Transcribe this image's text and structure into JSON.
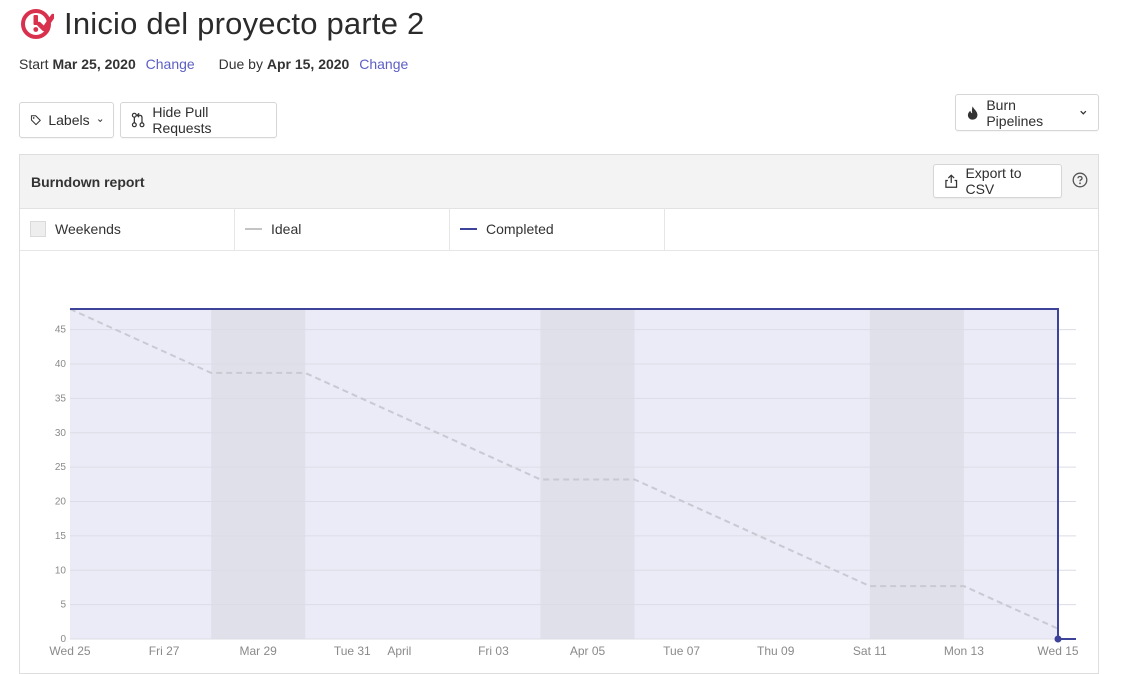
{
  "header": {
    "title": "Inicio del proyecto parte 2",
    "icon": "milestone-check-icon",
    "icon_color": "#d9304e"
  },
  "dates": {
    "start_label": "Start",
    "start_value": "Mar 25, 2020",
    "start_change": "Change",
    "due_label": "Due by",
    "due_value": "Apr 15, 2020",
    "due_change": "Change",
    "link_color": "#5c5fc4"
  },
  "toolbar": {
    "labels_button": "Labels",
    "hide_pr_button": "Hide Pull Requests",
    "burn_button": "Burn Pipelines"
  },
  "report": {
    "title": "Burndown report",
    "export_button": "Export to CSV"
  },
  "legend": {
    "weekends": "Weekends",
    "ideal": "Ideal",
    "completed": "Completed"
  },
  "colors": {
    "completed": "#3c4399",
    "ideal": "#c9c9d3",
    "plot_bg": "#ebebf7",
    "weekend_bg": "#e0e0ea"
  },
  "chart_data": {
    "type": "line",
    "x": [
      "2020-03-25",
      "2020-03-26",
      "2020-03-27",
      "2020-03-28",
      "2020-03-29",
      "2020-03-30",
      "2020-03-31",
      "2020-04-01",
      "2020-04-02",
      "2020-04-03",
      "2020-04-04",
      "2020-04-05",
      "2020-04-06",
      "2020-04-07",
      "2020-04-08",
      "2020-04-09",
      "2020-04-10",
      "2020-04-11",
      "2020-04-12",
      "2020-04-13",
      "2020-04-14",
      "2020-04-15"
    ],
    "x_tick_labels": [
      "Wed 25",
      "Fri 27",
      "Mar 29",
      "Tue 31",
      "April",
      "Fri 03",
      "Apr 05",
      "Tue 07",
      "Thu 09",
      "Sat 11",
      "Mon 13",
      "Wed 15"
    ],
    "x_tick_dates": [
      "2020-03-25",
      "2020-03-27",
      "2020-03-29",
      "2020-03-31",
      "2020-04-01",
      "2020-04-03",
      "2020-04-05",
      "2020-04-07",
      "2020-04-09",
      "2020-04-11",
      "2020-04-13",
      "2020-04-15"
    ],
    "weekends": [
      [
        "2020-03-28",
        "2020-03-30"
      ],
      [
        "2020-04-04",
        "2020-04-06"
      ],
      [
        "2020-04-11",
        "2020-04-13"
      ]
    ],
    "series": [
      {
        "name": "Ideal",
        "points": [
          [
            "2020-03-25",
            48
          ],
          [
            "2020-03-28",
            38.7
          ],
          [
            "2020-03-30",
            38.7
          ],
          [
            "2020-04-04",
            23.2
          ],
          [
            "2020-04-06",
            23.2
          ],
          [
            "2020-04-11",
            7.7
          ],
          [
            "2020-04-13",
            7.7
          ],
          [
            "2020-04-15",
            1.5
          ]
        ]
      },
      {
        "name": "Completed",
        "points": [
          [
            "2020-03-25",
            48
          ],
          [
            "2020-04-15",
            48
          ],
          [
            "2020-04-15",
            0
          ]
        ]
      }
    ],
    "y_ticks": [
      0,
      5,
      10,
      15,
      20,
      25,
      30,
      35,
      40,
      45
    ],
    "ylim": [
      0,
      48
    ],
    "grid": true
  }
}
